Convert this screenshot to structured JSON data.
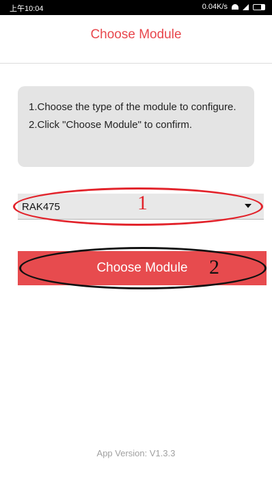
{
  "status_bar": {
    "time": "上午10:04",
    "speed": "0.04K/s"
  },
  "header": {
    "title": "Choose Module"
  },
  "instructions": {
    "line1": "1.Choose the type of the module to configure.",
    "line2": "2.Click \"Choose Module\" to confirm."
  },
  "module_select": {
    "selected": "RAK475"
  },
  "choose_button": {
    "label": "Choose Module"
  },
  "annotations": {
    "marker1": "1",
    "marker2": "2",
    "marker1_color": "#e2232b",
    "marker2_color": "#111111"
  },
  "footer": {
    "app_version": "App Version: V1.3.3"
  },
  "colors": {
    "accent": "#e8474d",
    "button_bg": "#e74b4e",
    "panel_bg": "#e4e4e4"
  }
}
